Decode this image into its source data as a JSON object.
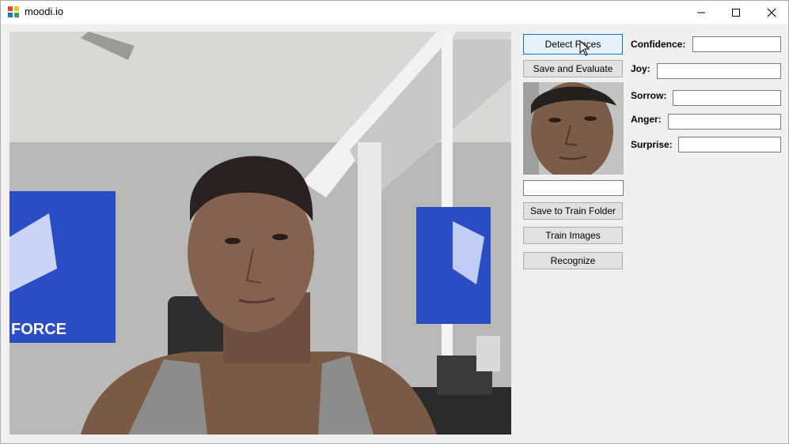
{
  "window": {
    "title": "moodi.io",
    "icons": {
      "app": "app-icon",
      "minimize": "minimize-icon",
      "maximize": "maximize-icon",
      "close": "close-icon"
    }
  },
  "buttons": {
    "detect_faces": "Detect Faces",
    "save_and_evaluate": "Save and Evaluate",
    "save_to_train_folder": "Save to Train Folder",
    "train_images": "Train Images",
    "recognize": "Recognize"
  },
  "inputs": {
    "name_value": "",
    "confidence_value": "",
    "joy_value": "",
    "sorrow_value": "",
    "anger_value": "",
    "surprise_value": ""
  },
  "labels": {
    "confidence": "Confidence:",
    "joy": "Joy:",
    "sorrow": "Sorrow:",
    "anger": "Anger:",
    "surprise": "Surprise:"
  },
  "images": {
    "video": "webcam-feed",
    "face": "detected-face-crop",
    "flag_text": "FORCE"
  },
  "colors": {
    "window_bg": "#f0f0f0",
    "button_bg": "#e1e1e1",
    "focus_border": "#0078d7",
    "flag_blue": "#2a4dc4"
  }
}
